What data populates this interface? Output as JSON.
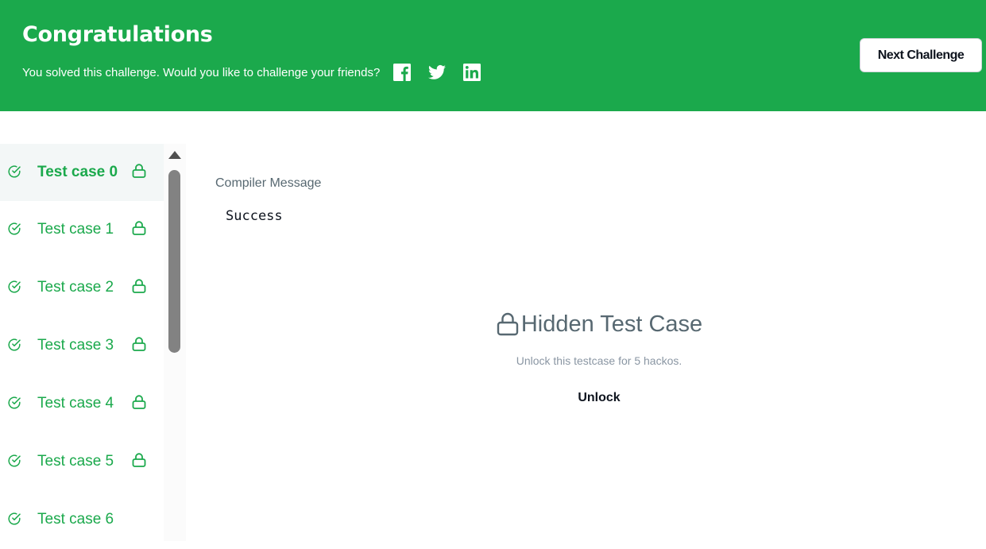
{
  "banner": {
    "title": "Congratulations",
    "subtitle": "You solved this challenge. Would you like to challenge your friends?",
    "social": [
      "facebook-icon",
      "twitter-icon",
      "linkedin-icon"
    ],
    "next_label": "Next Challenge",
    "background": "#1ba94c"
  },
  "test_cases": [
    {
      "label": "Test case 0",
      "passed": true,
      "locked": true,
      "active": true
    },
    {
      "label": "Test case 1",
      "passed": true,
      "locked": true,
      "active": false
    },
    {
      "label": "Test case 2",
      "passed": true,
      "locked": true,
      "active": false
    },
    {
      "label": "Test case 3",
      "passed": true,
      "locked": true,
      "active": false
    },
    {
      "label": "Test case 4",
      "passed": true,
      "locked": true,
      "active": false
    },
    {
      "label": "Test case 5",
      "passed": true,
      "locked": true,
      "active": false
    },
    {
      "label": "Test case 6",
      "passed": true,
      "locked": false,
      "active": false
    }
  ],
  "compiler": {
    "label": "Compiler Message",
    "value": "Success"
  },
  "hidden": {
    "title": "Hidden Test Case",
    "description": "Unlock this testcase for 5 hackos.",
    "unlock_label": "Unlock"
  },
  "colors": {
    "accent": "#1ba94c",
    "text_muted": "#576871"
  }
}
